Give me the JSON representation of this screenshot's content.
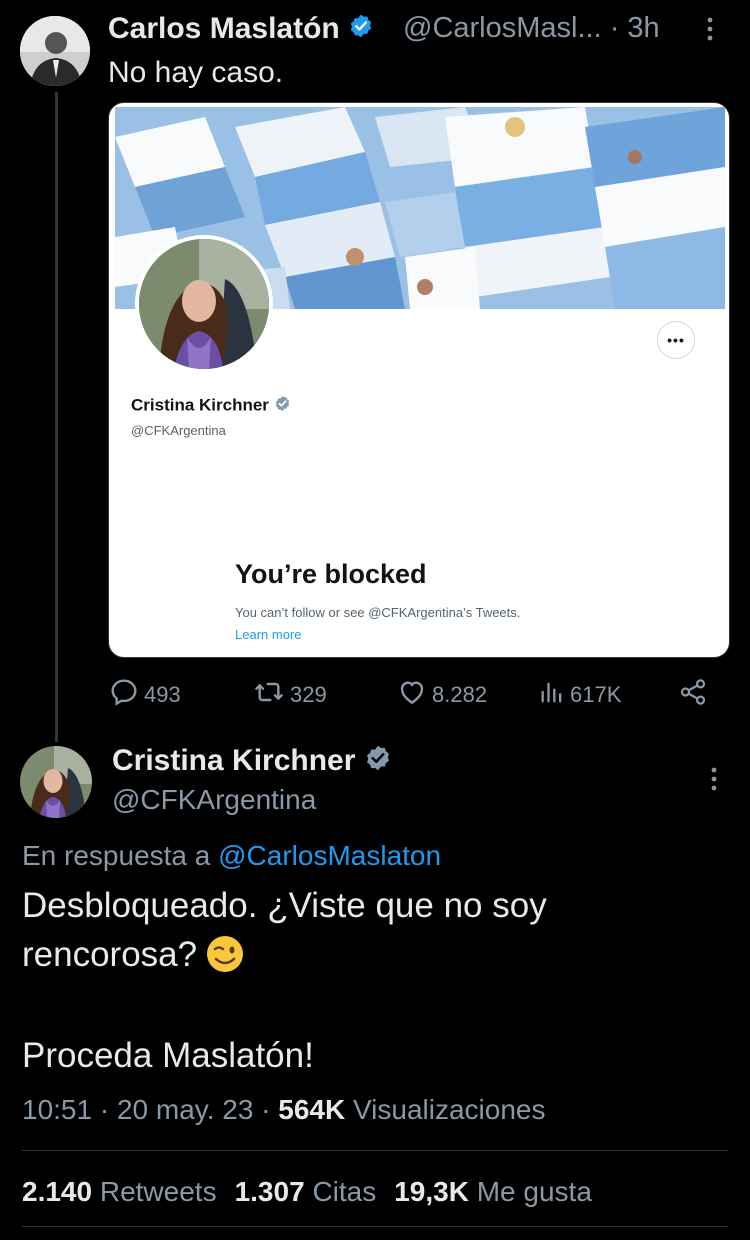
{
  "tweet1": {
    "author_name": "Carlos Maslatón",
    "handle": "@CarlosMasl...",
    "time": "· 3h",
    "text": "No hay caso.",
    "embedded_profile": {
      "name": "Cristina Kirchner",
      "handle": "@CFKArgentina",
      "more_label": "•••",
      "blocked_title": "You’re blocked",
      "blocked_desc": "You can’t follow or see @CFKArgentina’s Tweets.",
      "learn_more": "Learn more"
    },
    "actions": {
      "replies": "493",
      "retweets": "329",
      "likes": "8.282",
      "views": "617K"
    }
  },
  "tweet2": {
    "author_name": "Cristina Kirchner",
    "handle": "@CFKArgentina",
    "reply_prefix": "En respuesta a",
    "reply_mention": "@CarlosMaslaton",
    "text_line1": "Desbloqueado. ¿Viste que no soy",
    "text_line2": "rencorosa?",
    "text_line3": "Proceda Maslatón!",
    "time": "10:51 · 20 may. 23 ·",
    "views_count": "564K",
    "views_label": "Visualizaciones",
    "retweets_count": "2.140",
    "retweets_label": "Retweets",
    "quotes_count": "1.307",
    "quotes_label": "Citas",
    "likes_count": "19,3K",
    "likes_label": "Me gusta"
  },
  "colors": {
    "background": "#000000",
    "primary_text": "#e7e9ea",
    "secondary_text": "#8b98a5",
    "link": "#1d9bf0",
    "verified": "#1d9bf0",
    "card_background": "#ffffff"
  },
  "icons": [
    "verified-badge-icon",
    "more-icon",
    "reply-icon",
    "retweet-icon",
    "like-icon",
    "views-icon",
    "share-icon",
    "wink-emoji-icon"
  ]
}
